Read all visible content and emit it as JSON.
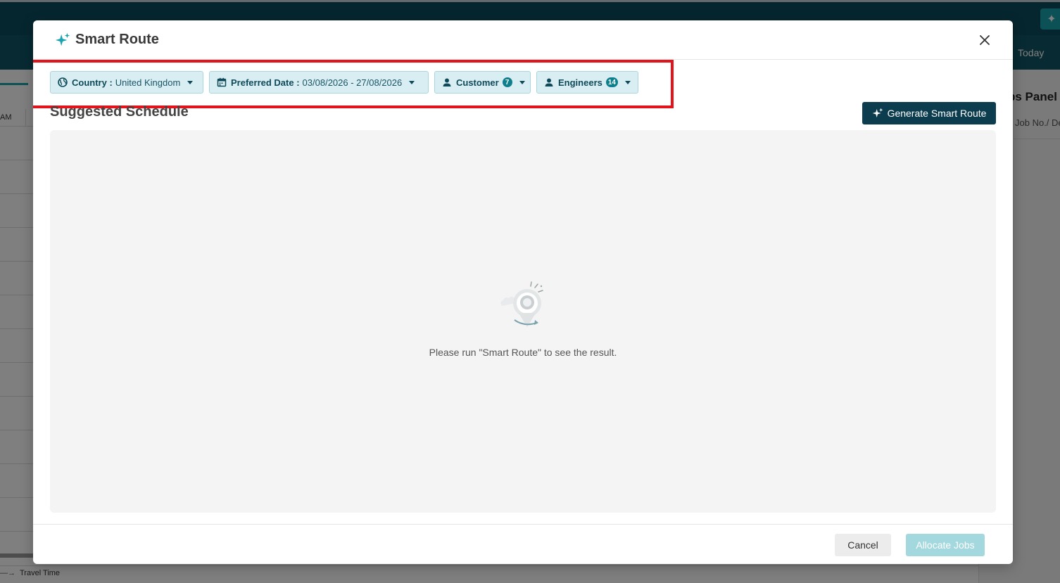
{
  "background": {
    "today_label": "Today",
    "time_label": "AM",
    "jobs_panel_title": "bs Panel",
    "jobs_panel_sub": "Job No./ De",
    "travel_time_label": "Travel Time"
  },
  "modal": {
    "title": "Smart Route",
    "filters": {
      "country": {
        "label": "Country :",
        "value": "United Kingdom"
      },
      "preferred_date": {
        "label": "Preferred Date :",
        "value": "03/08/2026 - 27/08/2026"
      },
      "customer": {
        "label": "Customer",
        "count": "7"
      },
      "engineers": {
        "label": "Engineers",
        "count": "14"
      }
    },
    "section_title": "Suggested Schedule",
    "generate_button": "Generate Smart Route",
    "empty_message": "Please run \"Smart Route\" to see the result.",
    "cancel_button": "Cancel",
    "allocate_button": "Allocate Jobs"
  },
  "colors": {
    "brand_dark": "#0c3d4f",
    "brand_teal": "#19a3ad",
    "chip_bg": "#d9eef2",
    "highlight": "#e3131b",
    "allocate_disabled": "#a2d8de"
  }
}
